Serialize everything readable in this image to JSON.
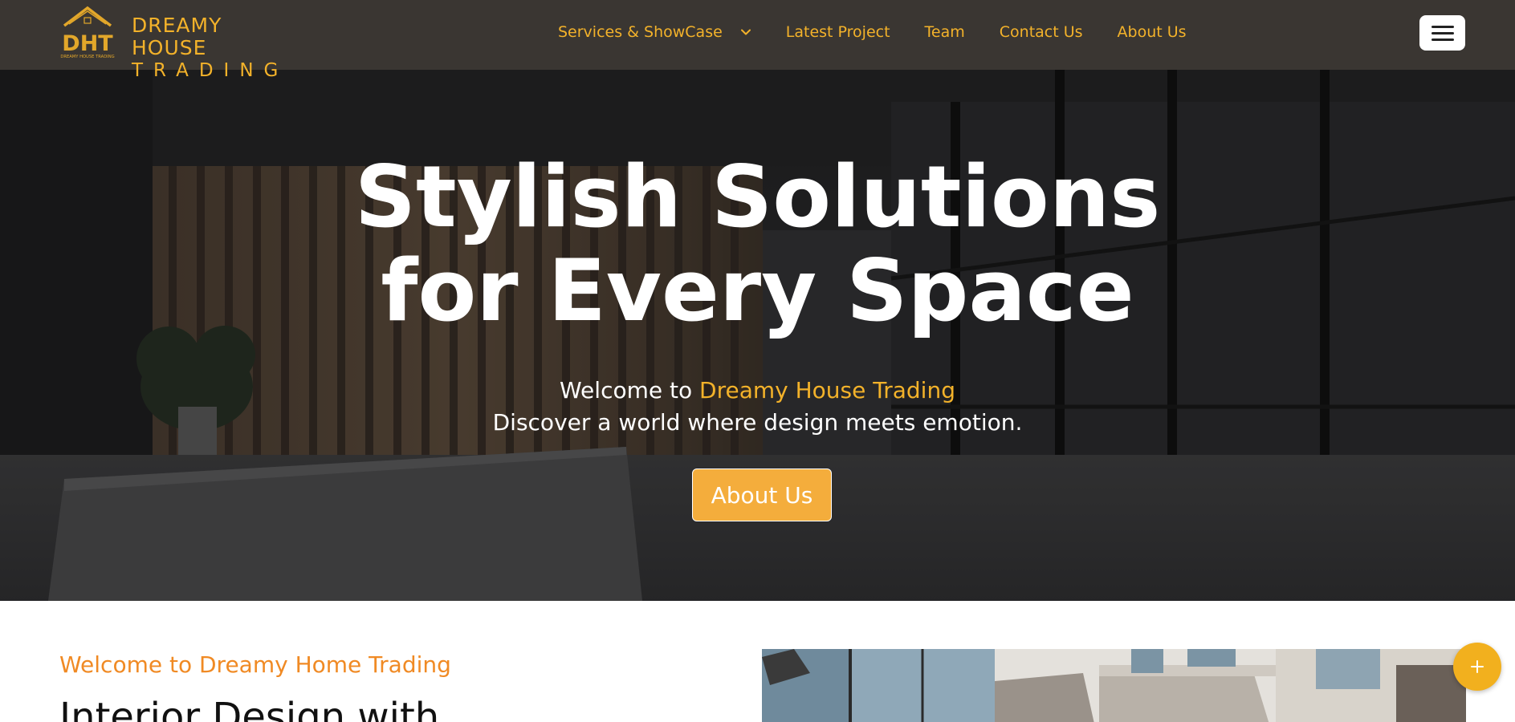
{
  "brand": {
    "logo_text": "DHT",
    "logo_subtext": "DREAMY HOUSE TRADING",
    "name_line1": "DREAMY HOUSE",
    "name_line2": "TRADING"
  },
  "nav": {
    "items": [
      {
        "label": "Services & ShowCase",
        "has_dropdown": true
      },
      {
        "label": "Latest Project"
      },
      {
        "label": "Team"
      },
      {
        "label": "Contact Us"
      },
      {
        "label": "About Us"
      }
    ],
    "menu_icon": "hamburger-icon"
  },
  "hero": {
    "title_line1": "Stylish Solutions",
    "title_line2": "for Every Space",
    "welcome_prefix": "Welcome to ",
    "welcome_highlight": "Dreamy House Trading",
    "tagline": "Discover a world where design meets emotion.",
    "button_label": "About Us"
  },
  "about": {
    "eyebrow": "Welcome to Dreamy Home Trading",
    "heading": "Interior Design with"
  },
  "fab": {
    "icon": "plus-icon"
  },
  "colors": {
    "navbar_bg": "#3a3632",
    "accent_gold": "#f3b22a",
    "button_orange": "#f4ad3c",
    "eyebrow_orange": "#f08a24",
    "fab_yellow": "#f2b01e"
  }
}
